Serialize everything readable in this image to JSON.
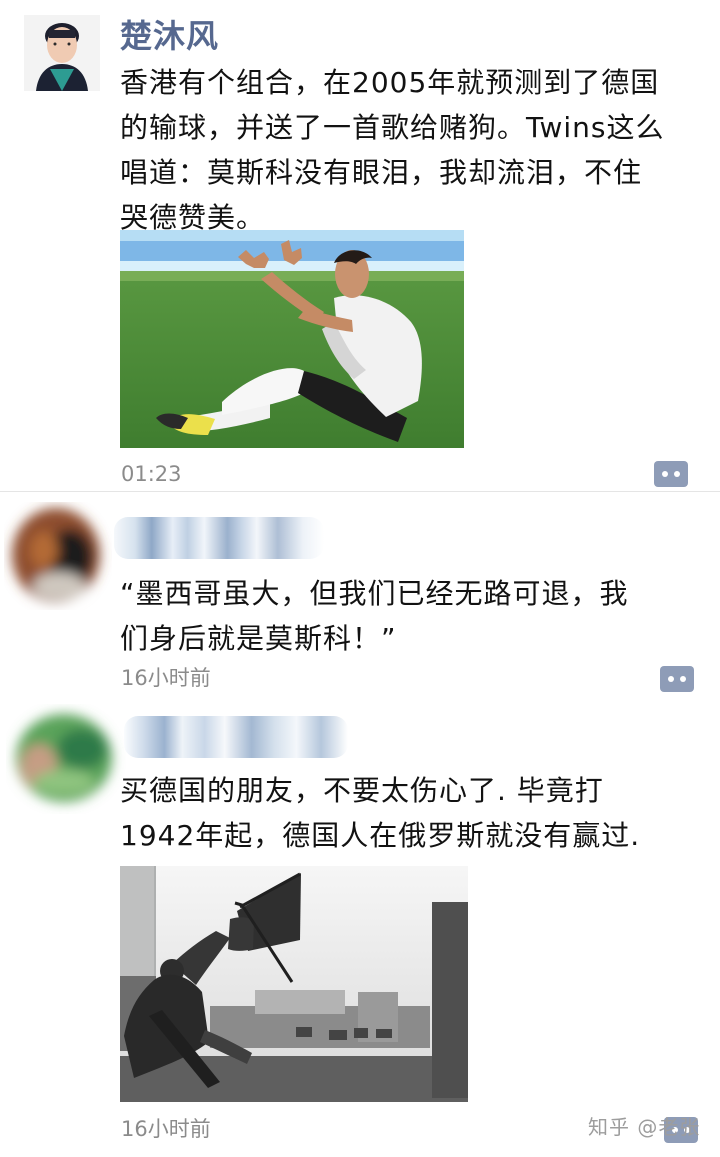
{
  "posts": [
    {
      "author": "楚沐风",
      "text": "香港有个组合，在2005年就预测到了德国\n的输球，并送了一首歌给赌狗。Twins这么\n唱道：莫斯科没有眼泪，我却流泪，不住\n哭德赞美。",
      "time": "01:23"
    },
    {
      "text": "“墨西哥虽大，但我们已经无路可退，我\n们身后就是莫斯科！”",
      "time": "16小时前"
    },
    {
      "text": "买德国的朋友，不要太伤心了. 毕竟打\n1942年起，德国人在俄罗斯就没有赢过.",
      "time": "16小时前"
    }
  ],
  "watermark": "知乎 @老张",
  "colors": {
    "name_blue": "#56688f",
    "comment_button": "#8e9cb7",
    "time_gray": "#8b8b8b",
    "field_green": "#4f8b39"
  },
  "icons": {
    "comment_button": "comment-bubble-icon"
  }
}
